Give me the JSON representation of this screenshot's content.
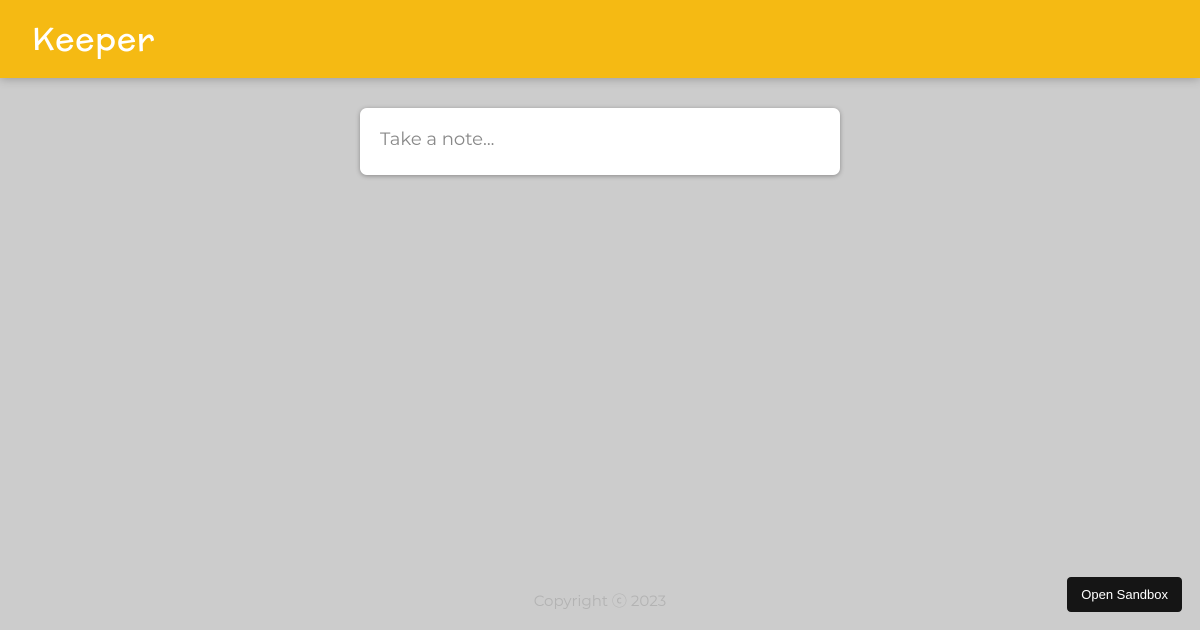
{
  "header": {
    "title": "Keeper"
  },
  "note_form": {
    "placeholder": "Take a note..."
  },
  "footer": {
    "copyright": "Copyright ⓒ 2023"
  },
  "sandbox": {
    "button_label": "Open Sandbox"
  },
  "colors": {
    "header_bg": "#f5ba13",
    "page_bg": "#cccccc",
    "card_bg": "#ffffff",
    "footer_text": "#b3b3b3"
  }
}
